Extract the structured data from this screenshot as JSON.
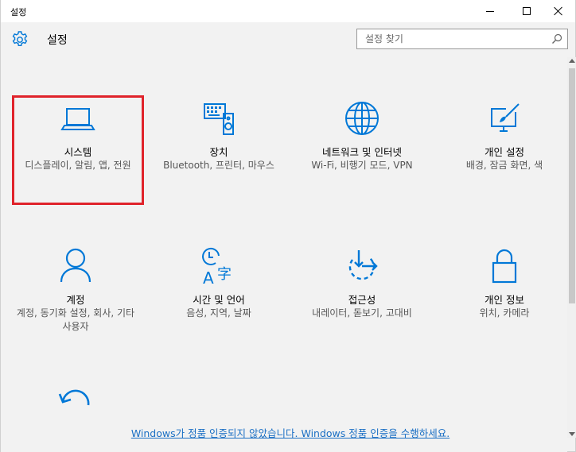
{
  "window": {
    "title": "설정"
  },
  "header": {
    "heading": "설정",
    "search_placeholder": "설정 찾기"
  },
  "tiles": [
    {
      "name": "시스템",
      "desc": "디스플레이, 알림, 앱, 전원",
      "icon": "laptop-icon",
      "selected": true
    },
    {
      "name": "장치",
      "desc": "Bluetooth, 프린터, 마우스",
      "icon": "devices-icon"
    },
    {
      "name": "네트워크 및 인터넷",
      "desc": "Wi-Fi, 비행기 모드, VPN",
      "icon": "globe-icon"
    },
    {
      "name": "개인 설정",
      "desc": "배경, 잠금 화면, 색",
      "icon": "personalization-icon"
    },
    {
      "name": "계정",
      "desc": "계정, 동기화 설정, 회사, 기타 사용자",
      "icon": "person-icon"
    },
    {
      "name": "시간 및 언어",
      "desc": "음성, 지역, 날짜",
      "icon": "time-language-icon"
    },
    {
      "name": "접근성",
      "desc": "내레이터, 돋보기, 고대비",
      "icon": "ease-of-access-icon"
    },
    {
      "name": "개인 정보",
      "desc": "위치, 카메라",
      "icon": "lock-icon"
    }
  ],
  "activation_link": "Windows가 정품 인증되지 않았습니다. Windows 정품 인증을 수행하세요.",
  "colors": {
    "accent": "#0078d7",
    "selection_outline": "#e0232b",
    "link": "#1a6fc4"
  }
}
